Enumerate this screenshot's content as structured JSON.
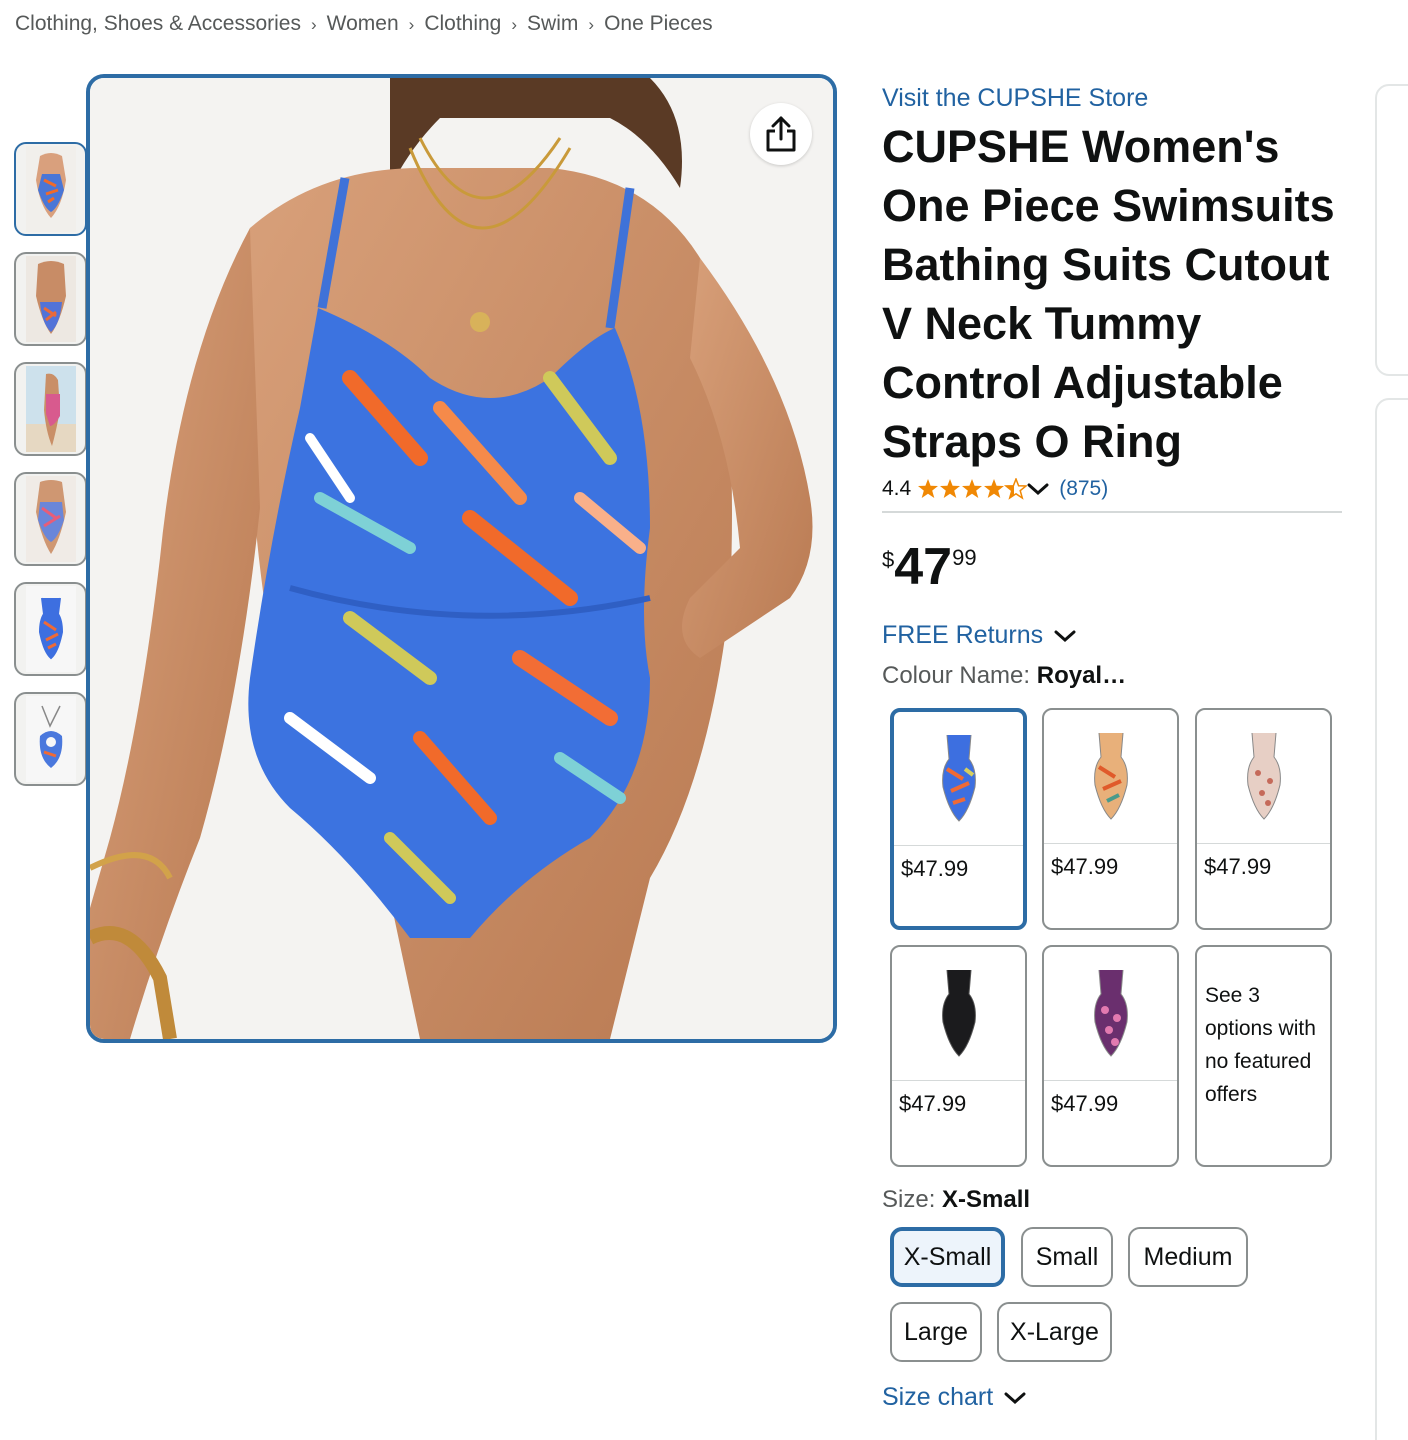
{
  "breadcrumb": {
    "items": [
      "Clothing, Shoes & Accessories",
      "Women",
      "Clothing",
      "Swim",
      "One Pieces"
    ],
    "separator": "›"
  },
  "gallery": {
    "thumbnail_count": 6,
    "selected_index": 0,
    "share_icon": "share-icon"
  },
  "product": {
    "store_link": "Visit the CUPSHE Store",
    "title": "CUPSHE Women's One Piece Swimsuits Bathing Suits Cutout V Neck Tummy Control Adjustable Straps O Ring",
    "rating": "4.4",
    "rating_stars": 4.4,
    "rating_count": "(875)",
    "price": {
      "symbol": "$",
      "whole": "47",
      "fraction": "99"
    },
    "free_returns": "FREE Returns"
  },
  "colour": {
    "label": "Colour Name:",
    "selected_value": "Royal…",
    "swatches": [
      {
        "price": "$47.99",
        "selected": true
      },
      {
        "price": "$47.99",
        "selected": false
      },
      {
        "price": "$47.99",
        "selected": false
      },
      {
        "price": "$47.99",
        "selected": false
      },
      {
        "price": "$47.99",
        "selected": false
      }
    ],
    "see_more": "See 3 options with no featured offers"
  },
  "size": {
    "label": "Size:",
    "selected_value": "X-Small",
    "options": [
      "X-Small",
      "Small",
      "Medium",
      "Large",
      "X-Large"
    ],
    "size_chart": "Size chart"
  },
  "colors": {
    "link": "#2162a1",
    "selected_border": "#2d6ca5",
    "star": "#f08804"
  }
}
